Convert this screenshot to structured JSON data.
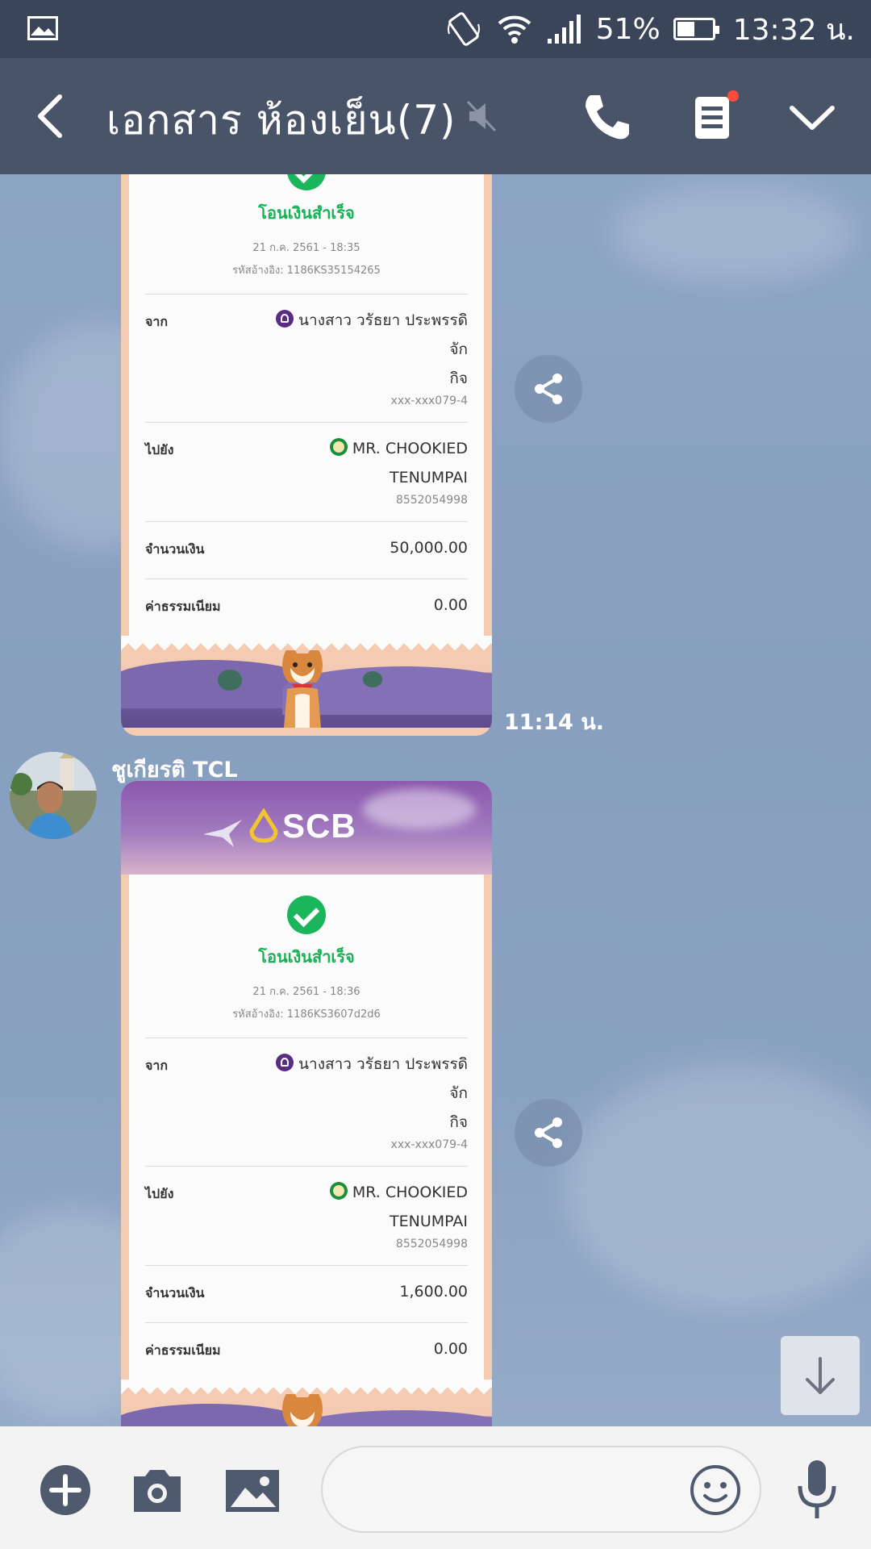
{
  "status": {
    "battery": "51%",
    "battery_level": 0.51,
    "time": "13:32 น."
  },
  "header": {
    "title": "เอกสาร ห้องเย็น(7)"
  },
  "messages": [
    {
      "status": "โอนเงินสำเร็จ",
      "date": "21 ก.ค. 2561 - 18:35",
      "ref": "รหัสอ้างอิง: 1186KS35154265",
      "from_label": "จาก",
      "from_name_1": "นางสาว วรัธยา ประพรรดิจัก",
      "from_name_2": "กิจ",
      "from_account": "xxx-xxx079-4",
      "to_label": "ไปยัง",
      "to_name_1": "MR. CHOOKIED",
      "to_name_2": "TENUMPAI",
      "to_account": "8552054998",
      "amount_label": "จำนวนเงิน",
      "amount": "50,000.00",
      "fee_label": "ค่าธรรมเนียม",
      "fee": "0.00",
      "time": "11:14 น."
    },
    {
      "sender": "ชูเกียรติ TCL",
      "bank_logo": "SCB",
      "status": "โอนเงินสำเร็จ",
      "date": "21 ก.ค. 2561 - 18:36",
      "ref": "รหัสอ้างอิง: 1186KS3607d2d6",
      "from_label": "จาก",
      "from_name_1": "นางสาว วรัธยา ประพรรดิจัก",
      "from_name_2": "กิจ",
      "from_account": "xxx-xxx079-4",
      "to_label": "ไปยัง",
      "to_name_1": "MR. CHOOKIED",
      "to_name_2": "TENUMPAI",
      "to_account": "8552054998",
      "amount_label": "จำนวนเงิน",
      "amount": "1,600.00",
      "fee_label": "ค่าธรรมเนียม",
      "fee": "0.00"
    }
  ],
  "composer": {
    "placeholder": ""
  },
  "colors": {
    "header": "#4a5469",
    "statusbar": "#3b4559",
    "success": "#1bb55c",
    "notification": "#ff4a3d"
  },
  "icons": [
    "gallery-icon",
    "rotate-icon",
    "wifi-icon",
    "signal-icon",
    "battery-icon",
    "back-arrow-icon",
    "mute-icon",
    "phone-icon",
    "notes-icon",
    "chevron-down-icon",
    "share-icon",
    "arrow-down-icon",
    "plus-icon",
    "camera-icon",
    "image-icon",
    "emoji-icon",
    "mic-icon"
  ]
}
